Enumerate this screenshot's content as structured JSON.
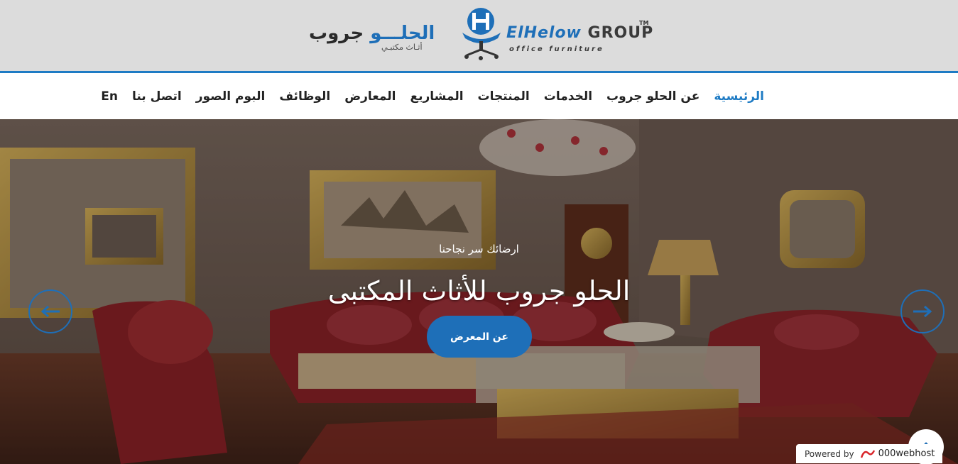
{
  "header": {
    "logo_ar_part1": "الحلـــو",
    "logo_ar_part2": " جروب",
    "logo_ar_sub": "أثـاث مكتبـي",
    "logo_en_part1": "ElHelow",
    "logo_en_part2": " GROUP",
    "logo_en_tm": "TM",
    "logo_en_sub": "office furniture"
  },
  "nav": {
    "items": [
      {
        "label": "الرئيسية",
        "active": true
      },
      {
        "label": "عن الحلو جروب"
      },
      {
        "label": "الخدمات"
      },
      {
        "label": "المنتجات"
      },
      {
        "label": "المشاريع"
      },
      {
        "label": "المعارض"
      },
      {
        "label": "الوظائف"
      },
      {
        "label": "البوم الصور"
      },
      {
        "label": "اتصل بنا"
      },
      {
        "label": "En"
      }
    ]
  },
  "hero": {
    "subtitle": "ارضائك سر نجاحنا",
    "title": "الحلو جروب للأثاث المكتبى",
    "button_label": "عن المعرض"
  },
  "footer_badge": {
    "powered_label": "Powered by",
    "brand": "000webhost"
  },
  "colors": {
    "accent": "#1e7bc4",
    "button": "#1e6fb8",
    "header_bg": "#dcdcdc"
  },
  "icons": {
    "prev": "arrow-left-icon",
    "next": "arrow-right-icon",
    "scroll_top": "chevron-up-icon",
    "brand": "webhost-logo-icon"
  }
}
